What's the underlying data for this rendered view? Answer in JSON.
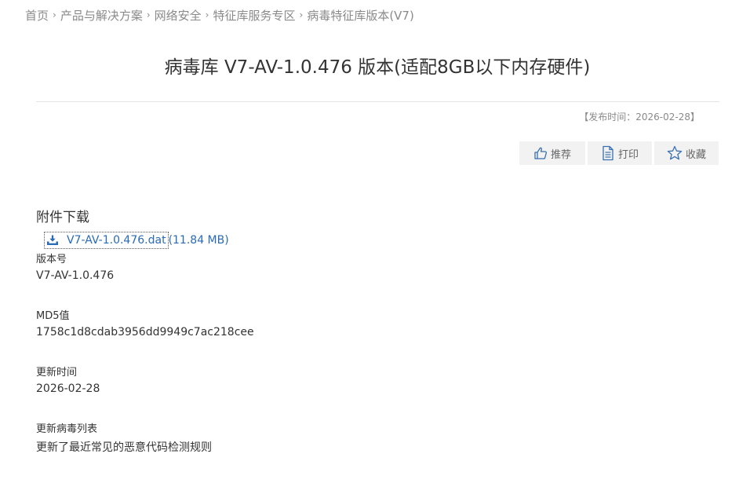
{
  "breadcrumb": {
    "items": [
      "首页",
      "产品与解决方案",
      "网络安全",
      "特征库服务专区",
      "病毒特征库版本(V7)"
    ],
    "separator": "›"
  },
  "title": "病毒库 V7-AV-1.0.476 版本(适配8GB以下内存硬件)",
  "publish_time": "【发布时间：2026-02-28】",
  "actions": {
    "recommend": "推荐",
    "print": "打印",
    "favorite": "收藏"
  },
  "attachments": {
    "heading": "附件下载",
    "file_name": "V7-AV-1.0.476.dat",
    "file_size": "(11.84 MB)"
  },
  "fields": {
    "version_label": "版本号",
    "version_value": "V7-AV-1.0.476",
    "md5_label": "MD5值",
    "md5_value": "1758c1d8cdab3956dd9949c7ac218cee",
    "update_time_label": "更新时间",
    "update_time_value": "2026-02-28",
    "virus_list_label": "更新病毒列表",
    "virus_list_value": "更新了最近常见的恶意代码检测规则"
  },
  "colors": {
    "link": "#2a6bb5",
    "muted": "#8a8a8a",
    "button_bg": "#f2f2f2",
    "icon": "#3a6fb0"
  }
}
